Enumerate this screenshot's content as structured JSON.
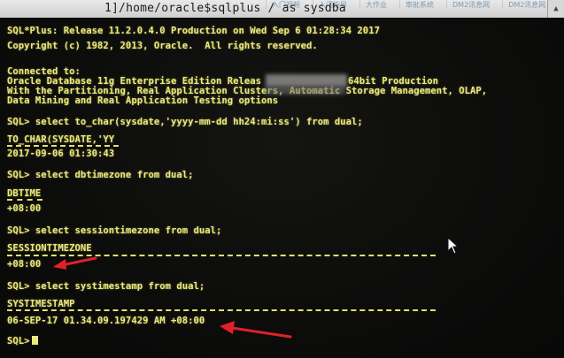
{
  "window": {
    "title": "1]/home/oracle$sqlplus / as sysdba",
    "taskbar_tabs": [
      "入门视频",
      "入门指导",
      "大作业",
      "审批系统",
      "DM2讯息网",
      "DM2讯息网"
    ]
  },
  "terminal": {
    "banner": {
      "line1": "SQL*Plus: Release 11.2.0.4.0 Production on Wed Sep 6 01:28:34 2017",
      "line2": "Copyright (c) 1982, 2013, Oracle.  All rights reserved.",
      "connected": "Connected to:",
      "db_line_start": "Oracle Database 11g Enterprise Edition Releas",
      "db_line_end": "64bit Production",
      "options_line": "With the Partitioning, Real Application Clusters, Automatic Storage Management, OLAP,",
      "options_line2": "Data Mining and Real Application Testing options"
    },
    "queries": [
      {
        "prompt": "SQL> select to_char(sysdate,'yyyy-mm-dd hh24:mi:ss') from dual;",
        "header": "TO_CHAR(SYSDATE,'YY",
        "value": "2017-09-06 01:30:43"
      },
      {
        "prompt": "SQL> select dbtimezone from dual;",
        "header": "DBTIME",
        "value": "+08:00"
      },
      {
        "prompt": "SQL> select sessiontimezone from dual;",
        "header": "SESSIONTIMEZONE",
        "value": "+08:00"
      },
      {
        "prompt": "SQL> select systimestamp from dual;",
        "header": "SYSTIMESTAMP",
        "value": "06-SEP-17 01.34.09.197429 AM +08:00"
      }
    ],
    "final_prompt": "SQL>"
  },
  "colors": {
    "terminal_text": "#ece97a",
    "background": "#0c0c0b",
    "annotation_arrow": "#e0202a"
  }
}
